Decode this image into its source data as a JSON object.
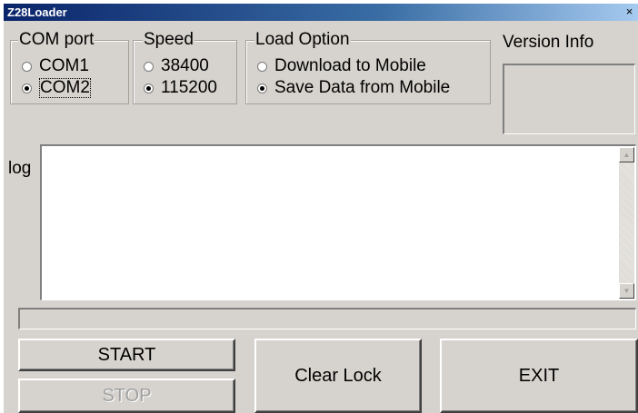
{
  "window": {
    "title": "Z28Loader",
    "close_glyph": "×"
  },
  "com_port": {
    "legend": "COM port",
    "options": [
      {
        "label": "COM1",
        "selected": false
      },
      {
        "label": "COM2",
        "selected": true
      }
    ]
  },
  "speed": {
    "legend": "Speed",
    "options": [
      {
        "label": "38400",
        "selected": false
      },
      {
        "label": "115200",
        "selected": true
      }
    ]
  },
  "load_option": {
    "legend": "Load Option",
    "options": [
      {
        "label": "Download to Mobile",
        "selected": false
      },
      {
        "label": "Save Data from Mobile",
        "selected": true
      }
    ]
  },
  "version_info": {
    "label": "Version Info",
    "value": ""
  },
  "log": {
    "label": "log",
    "content": "",
    "scroll_up_glyph": "▲",
    "scroll_down_glyph": "▼"
  },
  "progress": {
    "value": 0
  },
  "buttons": {
    "start": "START",
    "stop": "STOP",
    "clear_lock": "Clear Lock",
    "exit": "EXIT"
  },
  "colors": {
    "face": "#d6d3ce",
    "title_bar": "#0a246a",
    "disabled_text": "#a0a0a0"
  },
  "icons": {
    "close": "close-icon",
    "scroll_up": "scroll-up-arrow-icon",
    "scroll_down": "scroll-down-arrow-icon",
    "radio": "radio-button-icon"
  }
}
